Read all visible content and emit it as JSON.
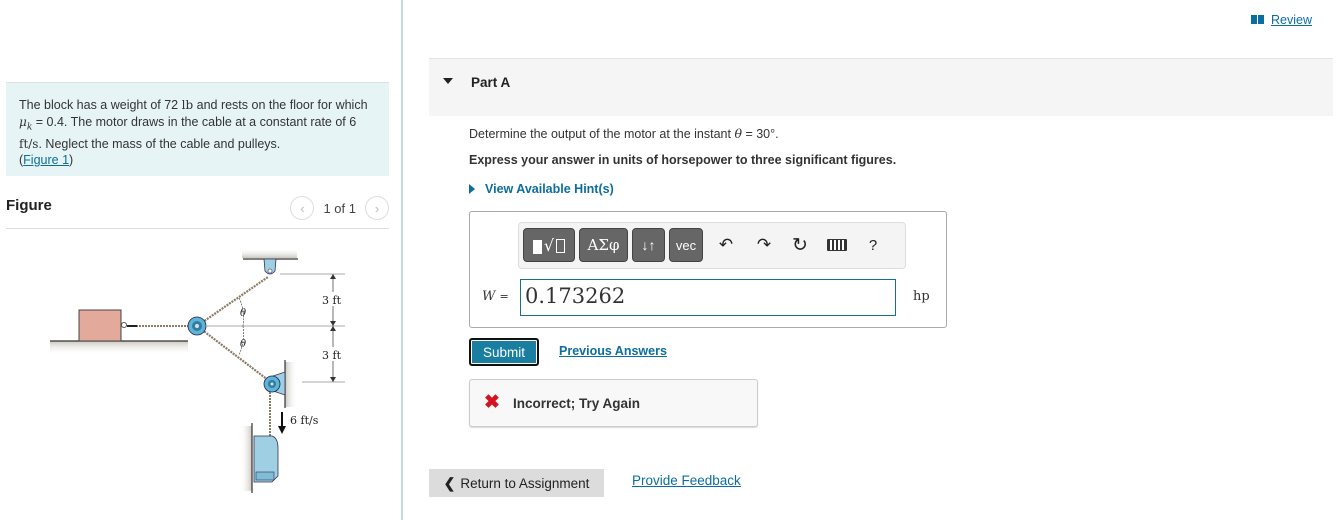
{
  "problem": {
    "text_part1": "The block has a weight of 72 ",
    "weight_unit": "lb",
    "text_part2": " and rests on the floor for which ",
    "mu_symbol": "μ",
    "mu_sub": "k",
    "text_part3": " = 0.4. The motor draws in the cable at a constant rate of 6 ",
    "rate_unit": "ft/s",
    "text_part4": ". Neglect the mass of the cable and pulleys.",
    "figure_link_open": "(",
    "figure_link": "Figure 1",
    "figure_link_close": ")"
  },
  "figure": {
    "title": "Figure",
    "pager_text": "1 of 1",
    "prev_icon": "chevron-left-icon",
    "next_icon": "chevron-right-icon",
    "labels": {
      "theta_top": "θ",
      "theta_bottom": "θ",
      "dim_top": "3 ft",
      "dim_bottom": "3 ft",
      "speed": "6 ft/s"
    },
    "colors": {
      "block": "#e3a99a",
      "pulley": "#5fb3d6",
      "bracket": "#9ecfe3",
      "rope": "#8a7a66"
    }
  },
  "header": {
    "review_label": "Review",
    "review_icon": "book-icon"
  },
  "part": {
    "title": "Part A",
    "question_prefix": "Determine the output of the motor at the instant ",
    "question_var": "θ",
    "question_suffix": " = 30°.",
    "instruction": "Express your answer in units of horsepower to three significant figures.",
    "hints_label": "View Available Hint(s)"
  },
  "toolbar": {
    "templates_icon": "templates-icon",
    "greek_label": "ΑΣφ",
    "arrows_label": "↓↑",
    "vec_label": "vec",
    "undo_icon": "undo-icon",
    "redo_icon": "redo-icon",
    "reset_icon": "reset-icon",
    "keyboard_icon": "keyboard-icon",
    "help_label": "?"
  },
  "answer": {
    "variable": "W",
    "equals": "=",
    "value": "0.173262",
    "unit": "hp"
  },
  "actions": {
    "submit_label": "Submit",
    "previous_answers_label": "Previous Answers"
  },
  "feedback": {
    "icon": "x-icon",
    "message": "Incorrect; Try Again",
    "color": "#d3131d"
  },
  "footer": {
    "return_label": "Return to Assignment",
    "provide_feedback_label": "Provide Feedback"
  },
  "colors": {
    "link": "#0b6e9e",
    "submit_bg": "#1a7ea0",
    "problem_bg": "#e6f4f5"
  }
}
